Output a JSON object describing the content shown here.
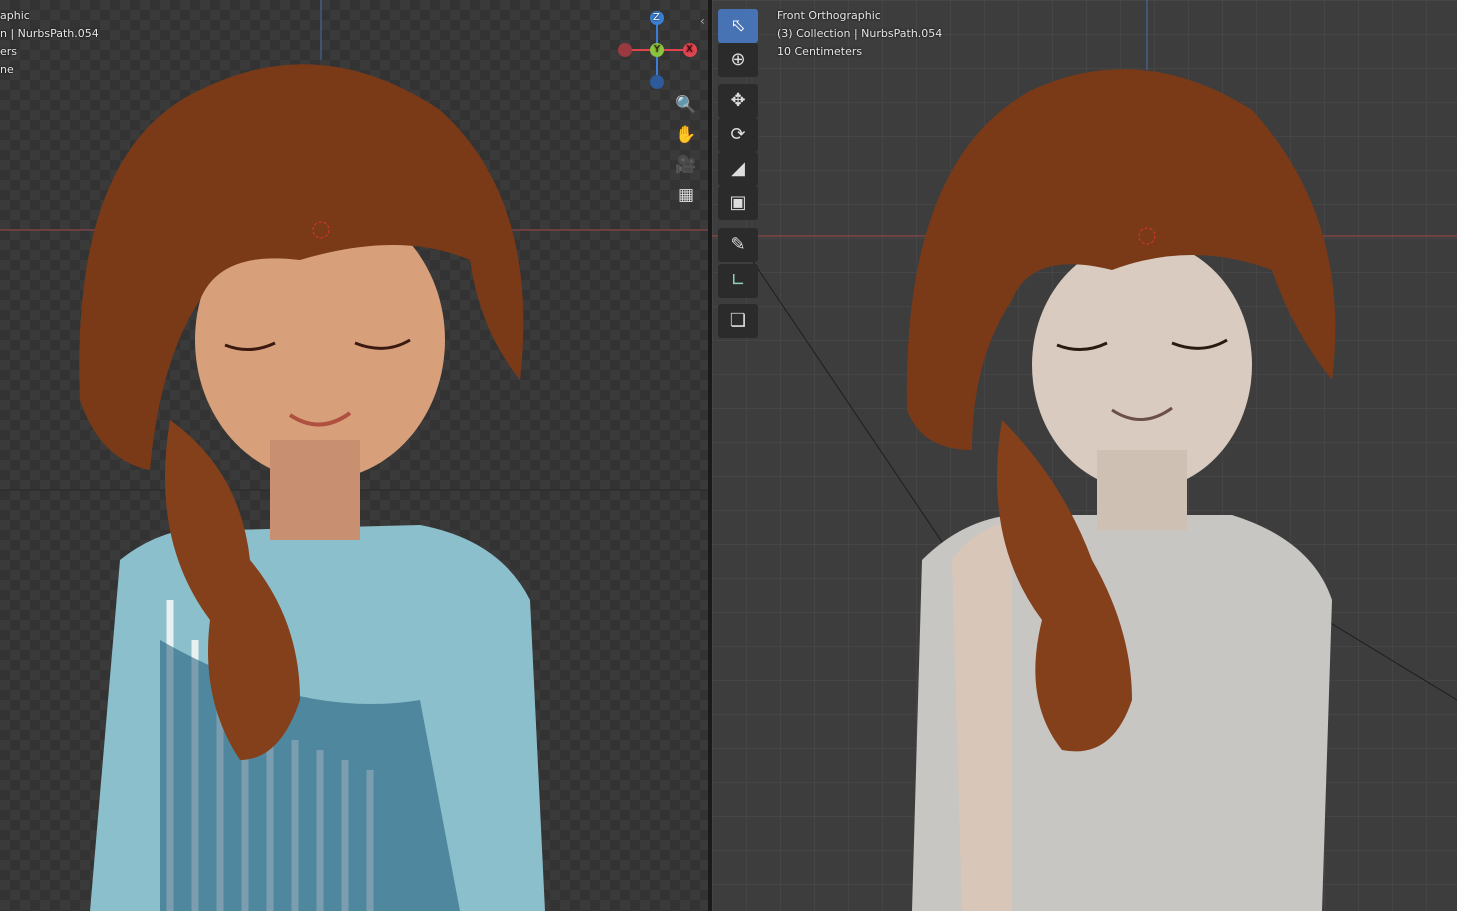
{
  "left_viewport": {
    "overlay_lines": [
      "aphic",
      "n | NurbsPath.054",
      "ers",
      "ne"
    ],
    "gizmo": {
      "x": "X",
      "y": "Y",
      "z": "Z"
    },
    "nav_icons": [
      "zoom-icon",
      "hand-pan-icon",
      "camera-icon",
      "grid-icon"
    ]
  },
  "right_viewport": {
    "view_name": "Front Orthographic",
    "collection": "(3) Collection | NurbsPath.054",
    "scale": "10 Centimeters"
  },
  "toolbar": [
    "select-box",
    "cursor",
    "move",
    "rotate",
    "scale",
    "transform",
    "annotate",
    "measure",
    "add-cube"
  ],
  "colors": {
    "active_tool": "#4772b3",
    "x_axis": "#e0454f",
    "y_axis": "#8bc53f",
    "z_axis": "#3a7fd6",
    "hair": "#7a3a18"
  }
}
